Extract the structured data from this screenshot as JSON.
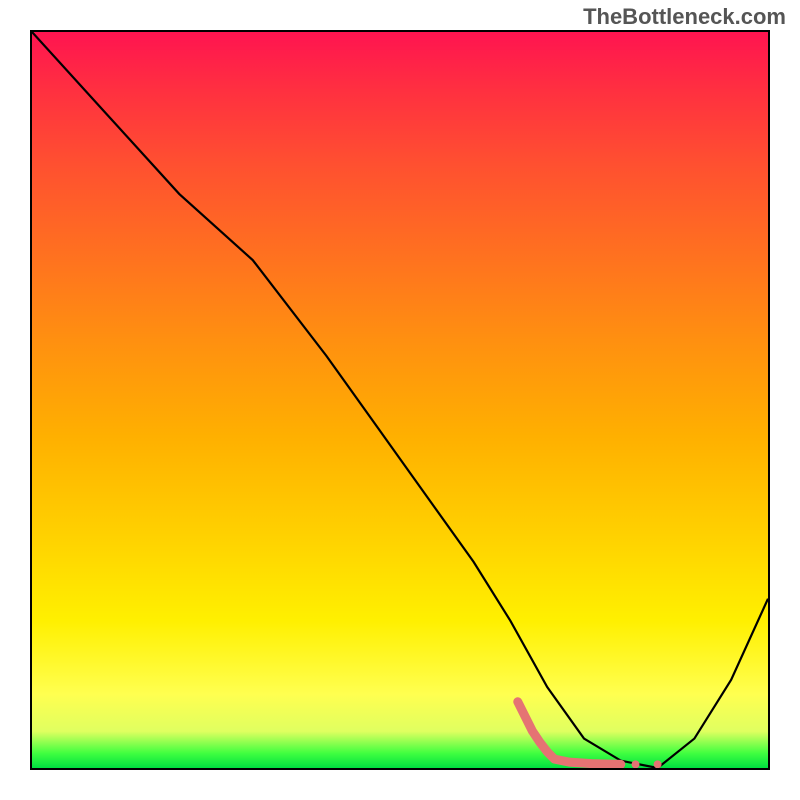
{
  "watermark": "TheBottleneck.com",
  "chart_data": {
    "type": "line",
    "title": "",
    "xlabel": "",
    "ylabel": "",
    "xlim": [
      0,
      100
    ],
    "ylim": [
      0,
      100
    ],
    "series": [
      {
        "name": "bottleneck-curve",
        "color": "#000000",
        "x": [
          0,
          10,
          20,
          30,
          40,
          50,
          60,
          65,
          70,
          75,
          80,
          85,
          90,
          95,
          100
        ],
        "y": [
          100,
          89,
          78,
          69,
          56,
          42,
          28,
          20,
          11,
          4,
          1,
          0,
          4,
          12,
          23
        ]
      }
    ],
    "markers": [
      {
        "name": "highlight-zone",
        "color": "#e57373",
        "x": [
          66,
          67,
          68,
          69,
          70,
          71,
          73,
          76,
          80
        ],
        "y": [
          9,
          7,
          5,
          3.5,
          2.2,
          1.2,
          0.8,
          0.6,
          0.5
        ]
      }
    ],
    "gradient_stops": [
      {
        "pos": 0,
        "color": "#ff1450"
      },
      {
        "pos": 55,
        "color": "#ffb000"
      },
      {
        "pos": 90,
        "color": "#ffff50"
      },
      {
        "pos": 100,
        "color": "#00e040"
      }
    ]
  }
}
